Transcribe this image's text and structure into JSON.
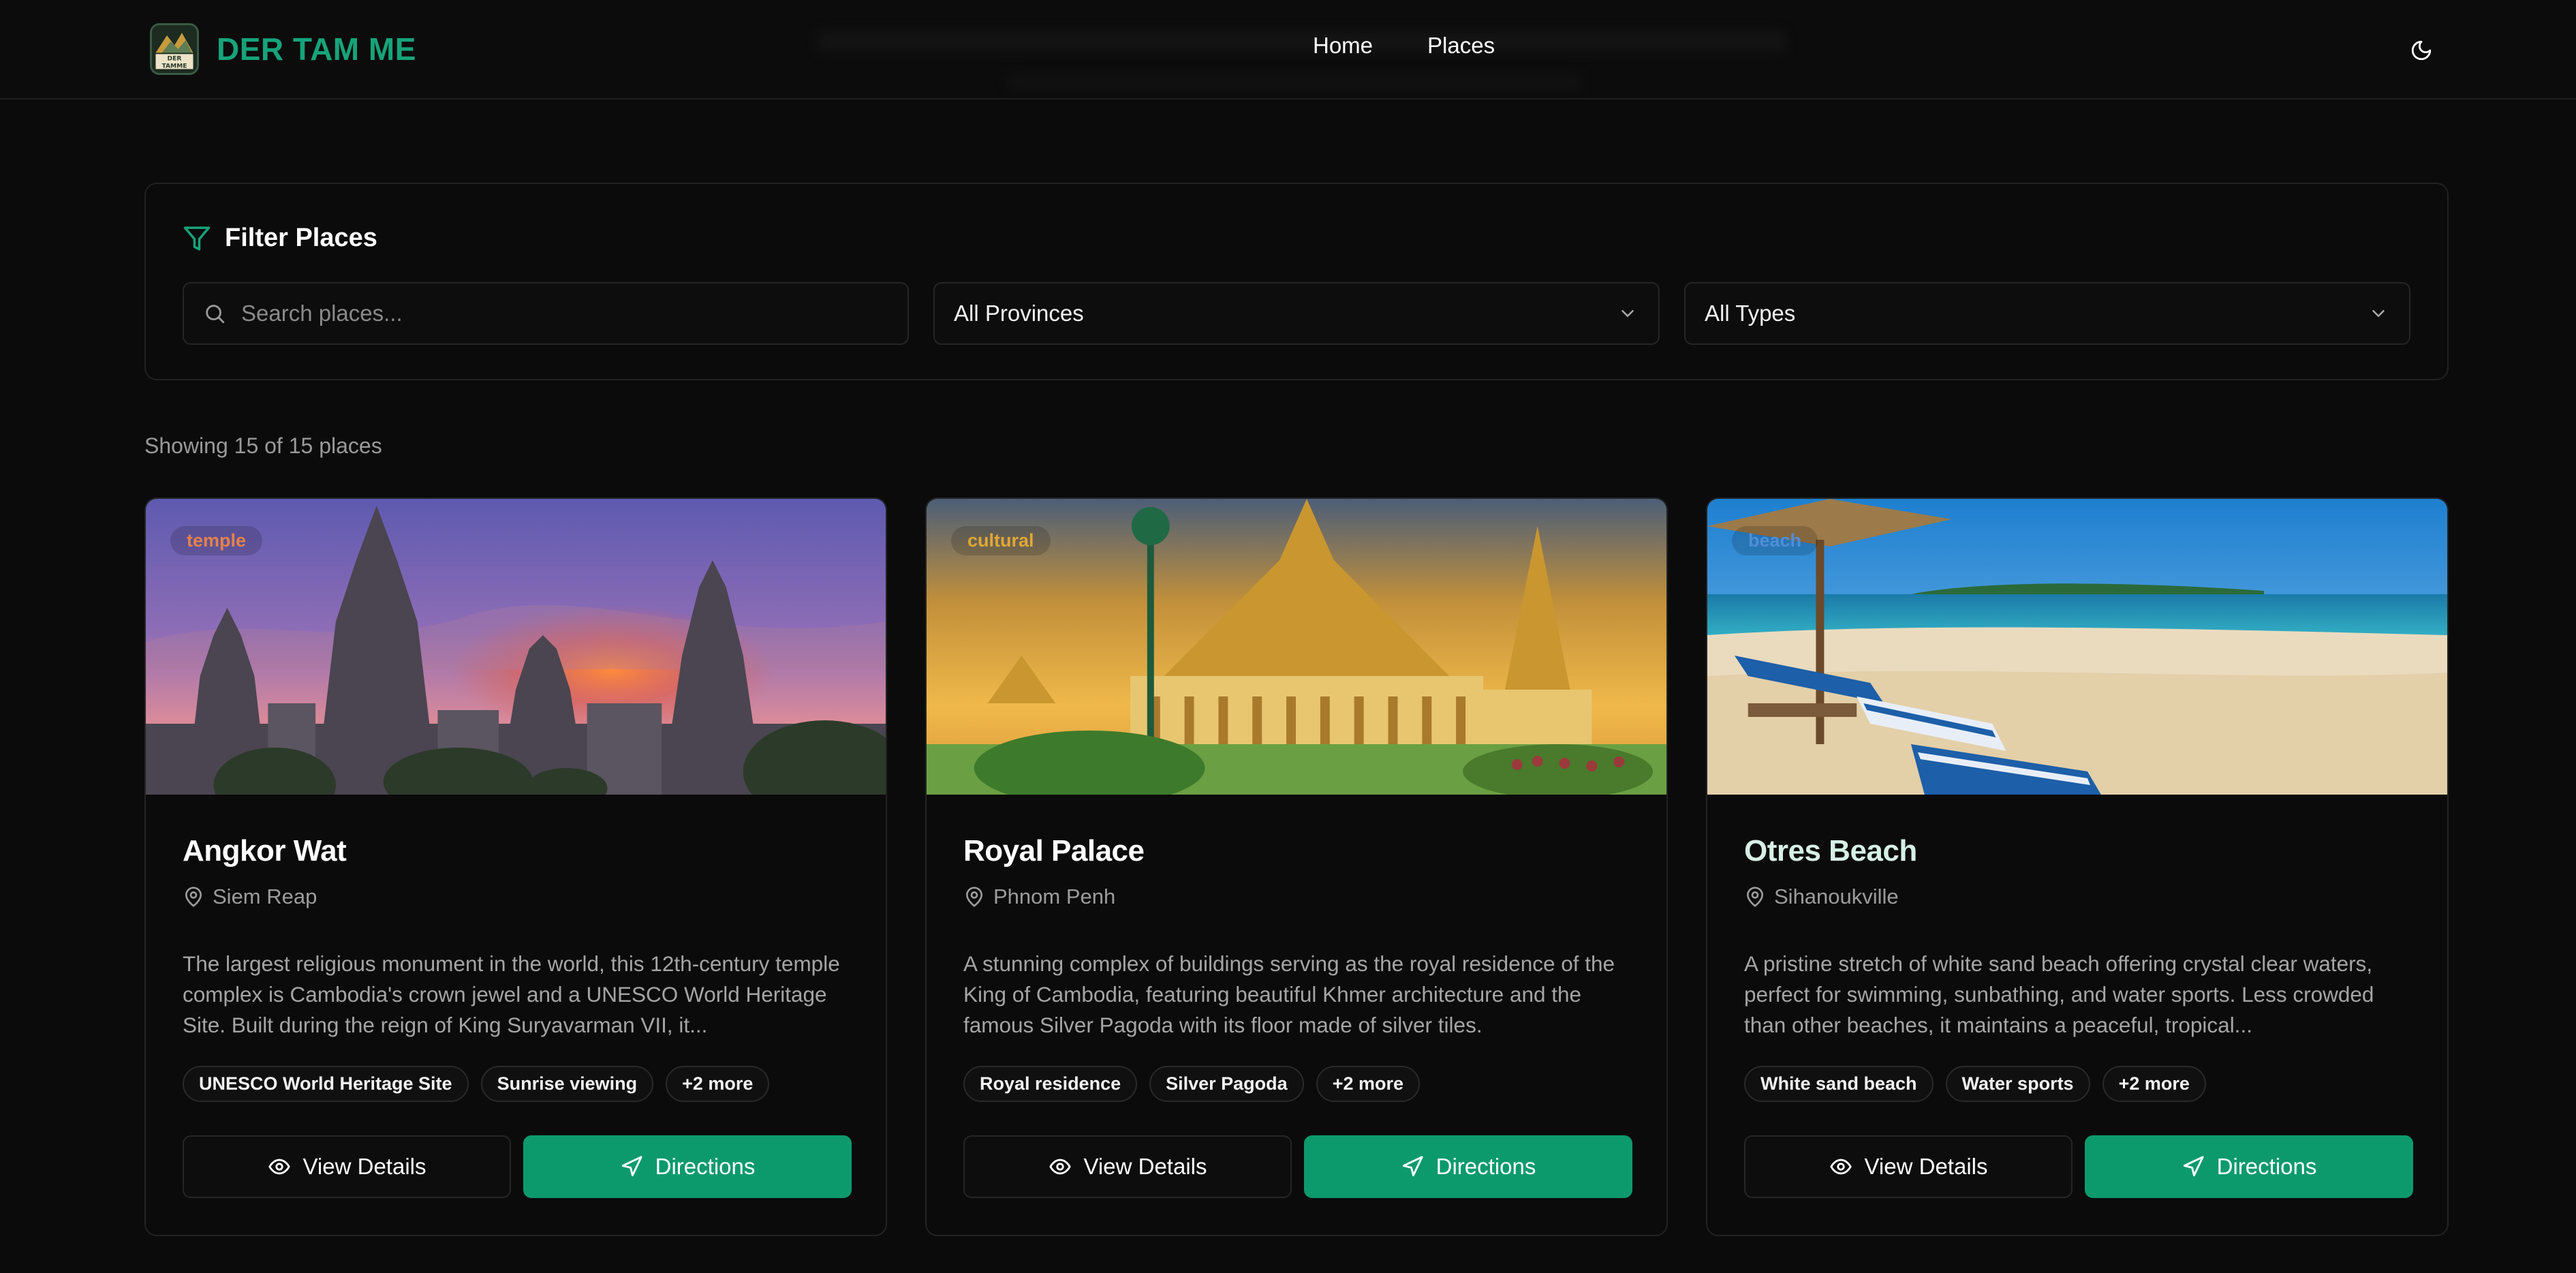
{
  "colors": {
    "brand": "#17a37a",
    "accent_button": "#0c9a6c",
    "background": "#0b0b0b"
  },
  "nav": {
    "brand": "DER TAM ME",
    "logo_text": "DER TAMME",
    "links": [
      {
        "label": "Home"
      },
      {
        "label": "Places"
      }
    ],
    "theme_icon": "moon-icon"
  },
  "filter": {
    "title": "Filter Places",
    "search_placeholder": "Search places...",
    "province": "All Provinces",
    "type": "All Types"
  },
  "results": {
    "showing": "Showing 15 of 15 places"
  },
  "cards": [
    {
      "badge": "temple",
      "badge_color": "#e3824a",
      "title": "Angkor Wat",
      "location": "Siem Reap",
      "description": "The largest religious monument in the world, this 12th-century temple complex is Cambodia's crown jewel and a UNESCO World Heritage Site. Built during the reign of King Suryavarman VII, it...",
      "tags": [
        "UNESCO World Heritage Site",
        "Sunrise viewing",
        "+2 more"
      ],
      "view_label": "View Details",
      "directions_label": "Directions"
    },
    {
      "badge": "cultural",
      "badge_color": "#e0a838",
      "title": "Royal Palace",
      "location": "Phnom Penh",
      "description": "A stunning complex of buildings serving as the royal residence of the King of Cambodia, featuring beautiful Khmer architecture and the famous Silver Pagoda with its floor made of silver tiles.",
      "tags": [
        "Royal residence",
        "Silver Pagoda",
        "+2 more"
      ],
      "view_label": "View Details",
      "directions_label": "Directions"
    },
    {
      "badge": "beach",
      "badge_color": "#4f8fd8",
      "title": "Otres Beach",
      "location": "Sihanoukville",
      "description": "A pristine stretch of white sand beach offering crystal clear waters, perfect for swimming, sunbathing, and water sports. Less crowded than other beaches, it maintains a peaceful, tropical...",
      "tags": [
        "White sand beach",
        "Water sports",
        "+2 more"
      ],
      "view_label": "View Details",
      "directions_label": "Directions"
    }
  ]
}
